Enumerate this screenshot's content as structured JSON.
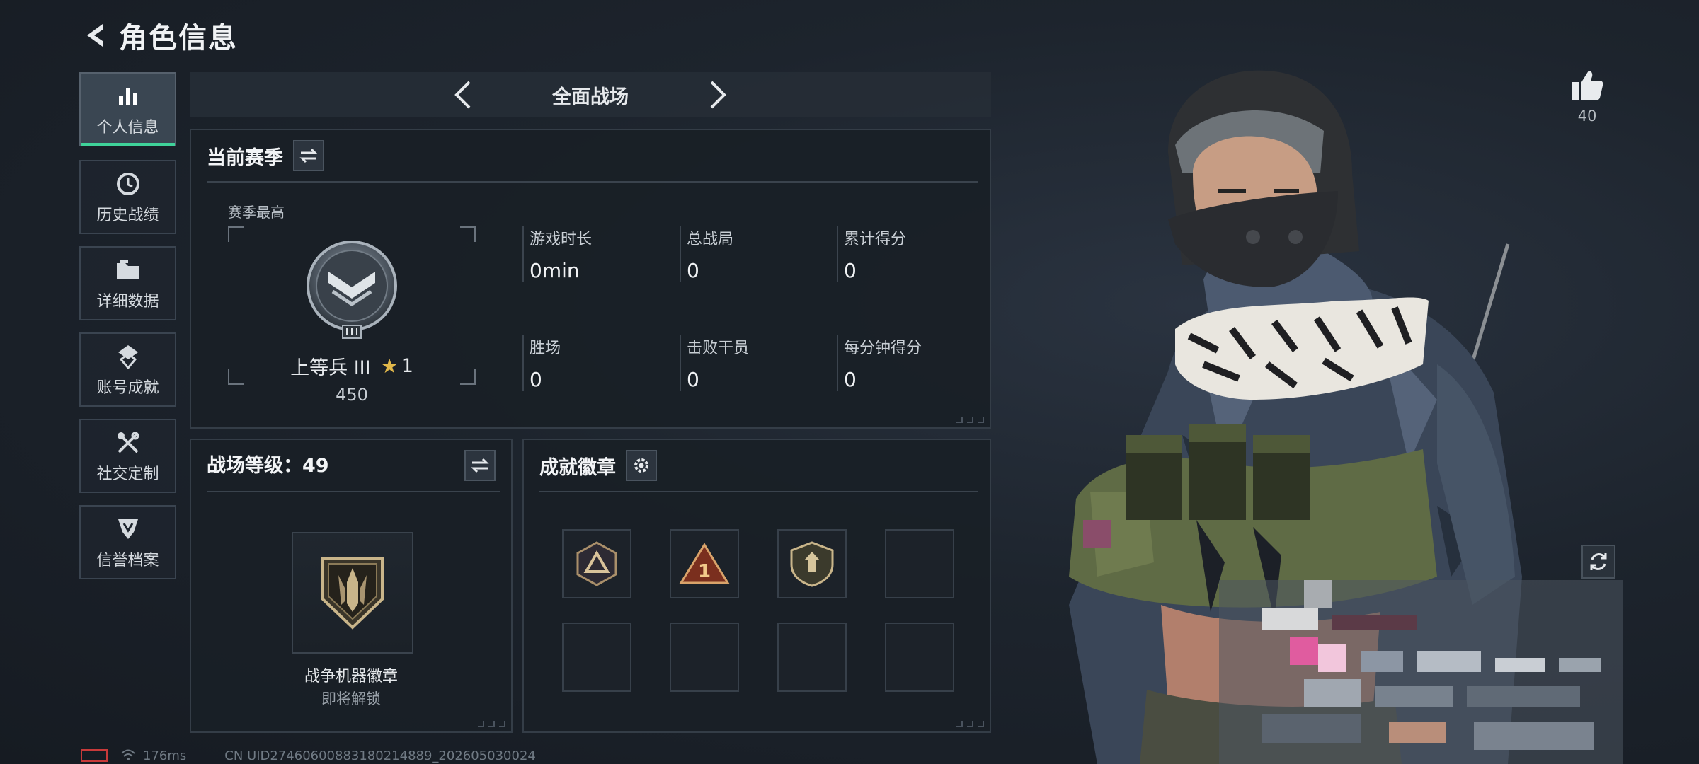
{
  "header": {
    "title": "角色信息"
  },
  "sidebar": {
    "items": [
      {
        "label": "个人信息",
        "icon": "bar-chart-icon",
        "active": true
      },
      {
        "label": "历史战绩",
        "icon": "history-clock-icon",
        "active": false
      },
      {
        "label": "详细数据",
        "icon": "folder-icon",
        "active": false
      },
      {
        "label": "账号成就",
        "icon": "achievement-icon",
        "active": false
      },
      {
        "label": "社交定制",
        "icon": "tools-icon",
        "active": false
      },
      {
        "label": "信誉档案",
        "icon": "shield-icon",
        "active": false
      }
    ]
  },
  "mode": {
    "title": "全面战场"
  },
  "season": {
    "title": "当前赛季",
    "best_label": "赛季最高",
    "rank_name": "上等兵 III",
    "rank_stars": "1",
    "rank_score": "450",
    "stats": [
      {
        "label": "游戏时长",
        "value": "0min"
      },
      {
        "label": "总战局",
        "value": "0"
      },
      {
        "label": "累计得分",
        "value": "0"
      },
      {
        "label": "胜场",
        "value": "0"
      },
      {
        "label": "击败干员",
        "value": "0"
      },
      {
        "label": "每分钟得分",
        "value": "0"
      }
    ]
  },
  "level": {
    "title": "战场等级：49",
    "badge_name": "战争机器徽章",
    "badge_status": "即将解锁"
  },
  "achievements": {
    "title": "成就徽章",
    "slots": [
      "badge-triangle-icon",
      "badge-number-one-icon",
      "badge-shield-icon",
      "",
      "",
      "",
      "",
      ""
    ]
  },
  "social": {
    "likes": "40"
  },
  "footer": {
    "ping": "176ms",
    "uid": "CN UID27460600883180214889_202605030024"
  },
  "colors": {
    "accent": "#3fd39a",
    "gold": "#e1b84a",
    "alert": "#c83a3a"
  }
}
